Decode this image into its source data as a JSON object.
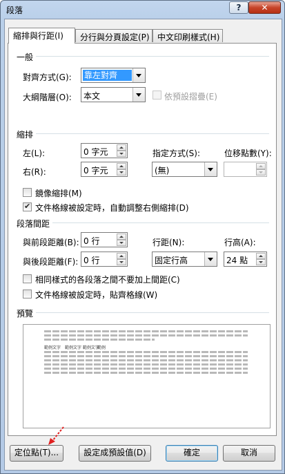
{
  "window": {
    "title": "段落",
    "help_label": "?",
    "close_label": "✕"
  },
  "tabs": [
    {
      "label": "縮排與行距(I)"
    },
    {
      "label": "分行與分頁設定(P)"
    },
    {
      "label": "中文印刷樣式(H)"
    }
  ],
  "general": {
    "section": "一般",
    "alignment_label": "對齊方式(G):",
    "alignment_value": "靠左對齊",
    "outline_label": "大綱階層(O):",
    "outline_value": "本文",
    "collapse_label": "依預設摺疊(E)"
  },
  "indent": {
    "section": "縮排",
    "left_label": "左(L):",
    "left_value": "0 字元",
    "right_label": "右(R):",
    "right_value": "0 字元",
    "special_label": "指定方式(S):",
    "special_value": "(無)",
    "by_label": "位移點數(Y):",
    "by_value": "",
    "mirror_label": "鏡像縮排(M)",
    "mirror_checked": false,
    "auto_adjust_label": "文件格線被設定時，自動調整右側縮排(D)",
    "auto_adjust_checked": true
  },
  "spacing": {
    "section": "段落間距",
    "before_label": "與前段距離(B):",
    "before_value": "0 行",
    "after_label": "與後段距離(F):",
    "after_value": "0 行",
    "line_spacing_label": "行距(N):",
    "line_spacing_value": "固定行高",
    "at_label": "行高(A):",
    "at_value": "24 點",
    "no_space_label": "相同樣式的各段落之間不要加上間距(C)",
    "no_space_checked": false,
    "snap_grid_label": "文件格線被設定時，貼齊格線(W)",
    "snap_grid_checked": false
  },
  "preview": {
    "section": "預覽",
    "sample_a": "範例文字",
    "sample_b": "範例文字 範例文字",
    "sample_c": "範例"
  },
  "buttons": {
    "tabs_label": "定位點(T)...",
    "set_default_label": "設定成預設值(D)",
    "ok_label": "確定",
    "cancel_label": "取消"
  },
  "colors": {
    "selection": "#3399ff",
    "pointer": "#e02020"
  }
}
